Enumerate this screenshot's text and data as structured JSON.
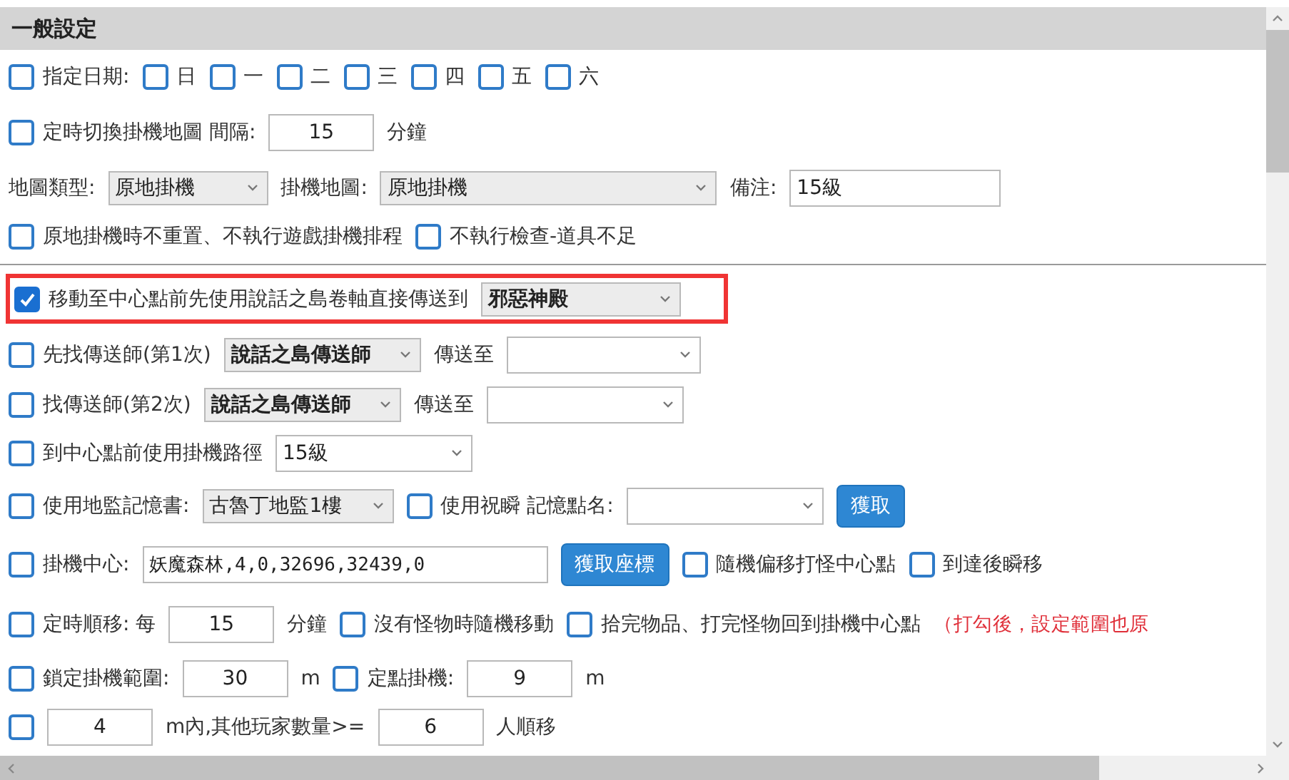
{
  "section_title": "一般設定",
  "rows": [
    {
      "highlighted": false,
      "divider_before": false,
      "items": [
        {
          "kind": "checkbox",
          "checked": false,
          "label": "指定日期:"
        },
        {
          "kind": "checkbox",
          "checked": false,
          "label": "日"
        },
        {
          "kind": "checkbox",
          "checked": false,
          "label": "一"
        },
        {
          "kind": "checkbox",
          "checked": false,
          "label": "二"
        },
        {
          "kind": "checkbox",
          "checked": false,
          "label": "三"
        },
        {
          "kind": "checkbox",
          "checked": false,
          "label": "四"
        },
        {
          "kind": "checkbox",
          "checked": false,
          "label": "五"
        },
        {
          "kind": "checkbox",
          "checked": false,
          "label": "六"
        }
      ]
    },
    {
      "highlighted": false,
      "divider_before": false,
      "items": [
        {
          "kind": "checkbox",
          "checked": false,
          "label": "定時切換掛機地圖 間隔:"
        },
        {
          "kind": "input",
          "value": "15"
        },
        {
          "kind": "text",
          "text": "分鐘"
        }
      ]
    },
    {
      "highlighted": false,
      "divider_before": false,
      "items": [
        {
          "kind": "text",
          "text": "地圖類型:"
        },
        {
          "kind": "select",
          "value": "原地掛機",
          "bold": false
        },
        {
          "kind": "text",
          "text": "掛機地圖:"
        },
        {
          "kind": "select",
          "value": "原地掛機",
          "bold": false
        },
        {
          "kind": "text",
          "text": "備注:"
        },
        {
          "kind": "input",
          "value": "15級"
        }
      ]
    },
    {
      "highlighted": false,
      "divider_before": false,
      "items": [
        {
          "kind": "checkbox",
          "checked": false,
          "label": "原地掛機時不重置、不執行遊戲掛機排程"
        },
        {
          "kind": "checkbox",
          "checked": false,
          "label": "不執行檢查-道具不足"
        }
      ]
    },
    {
      "highlighted": true,
      "divider_before": true,
      "items": [
        {
          "kind": "checkbox",
          "checked": true,
          "label": "移動至中心點前先使用說話之島卷軸直接傳送到"
        },
        {
          "kind": "select",
          "value": "邪惡神殿",
          "bold": true
        }
      ]
    },
    {
      "highlighted": false,
      "divider_before": false,
      "items": [
        {
          "kind": "checkbox",
          "checked": false,
          "label": "先找傳送師(第1次)"
        },
        {
          "kind": "select",
          "value": "說話之島傳送師",
          "bold": true
        },
        {
          "kind": "text",
          "text": "傳送至"
        },
        {
          "kind": "picker",
          "value": ""
        }
      ]
    },
    {
      "highlighted": false,
      "divider_before": false,
      "items": [
        {
          "kind": "checkbox",
          "checked": false,
          "label": "找傳送師(第2次)"
        },
        {
          "kind": "select",
          "value": "說話之島傳送師",
          "bold": true
        },
        {
          "kind": "text",
          "text": "傳送至"
        },
        {
          "kind": "picker",
          "value": ""
        }
      ]
    },
    {
      "highlighted": false,
      "divider_before": false,
      "items": [
        {
          "kind": "checkbox",
          "checked": false,
          "label": "到中心點前使用掛機路徑"
        },
        {
          "kind": "picker",
          "value": "15級"
        }
      ]
    },
    {
      "highlighted": false,
      "divider_before": false,
      "items": [
        {
          "kind": "checkbox",
          "checked": false,
          "label": "使用地監記憶書:"
        },
        {
          "kind": "select",
          "value": "古魯丁地監1樓",
          "bold": false
        },
        {
          "kind": "checkbox",
          "checked": false,
          "label": "使用祝瞬 記憶點名:"
        },
        {
          "kind": "picker",
          "value": ""
        },
        {
          "kind": "button",
          "label": "獲取"
        }
      ]
    },
    {
      "highlighted": false,
      "divider_before": false,
      "items": [
        {
          "kind": "checkbox",
          "checked": false,
          "label": "掛機中心:"
        },
        {
          "kind": "input",
          "value": "妖魔森林,4,0,32696,32439,0"
        },
        {
          "kind": "button",
          "label": "獲取座標"
        },
        {
          "kind": "checkbox",
          "checked": false,
          "label": "隨機偏移打怪中心點"
        },
        {
          "kind": "checkbox",
          "checked": false,
          "label": "到達後瞬移"
        }
      ]
    },
    {
      "highlighted": false,
      "divider_before": false,
      "items": [
        {
          "kind": "checkbox",
          "checked": false,
          "label": "定時順移: 每"
        },
        {
          "kind": "input",
          "value": "15"
        },
        {
          "kind": "text",
          "text": "分鐘"
        },
        {
          "kind": "checkbox",
          "checked": false,
          "label": "沒有怪物時隨機移動"
        },
        {
          "kind": "checkbox",
          "checked": false,
          "label": "拾完物品、打完怪物回到掛機中心點"
        },
        {
          "kind": "note",
          "text": "（打勾後，設定範圍也原"
        }
      ]
    },
    {
      "highlighted": false,
      "divider_before": false,
      "items": [
        {
          "kind": "checkbox",
          "checked": false,
          "label": "鎖定掛機範圍:"
        },
        {
          "kind": "input",
          "value": "30"
        },
        {
          "kind": "text",
          "text": "m"
        },
        {
          "kind": "checkbox",
          "checked": false,
          "label": "定點掛機:"
        },
        {
          "kind": "input",
          "value": "9"
        },
        {
          "kind": "text",
          "text": "m"
        }
      ]
    },
    {
      "highlighted": false,
      "divider_before": false,
      "items": [
        {
          "kind": "checkbox",
          "checked": false
        },
        {
          "kind": "input",
          "value": "4"
        },
        {
          "kind": "text",
          "text": "m內,其他玩家數量>="
        },
        {
          "kind": "input",
          "value": "6"
        },
        {
          "kind": "text",
          "text": "人順移"
        }
      ]
    }
  ]
}
